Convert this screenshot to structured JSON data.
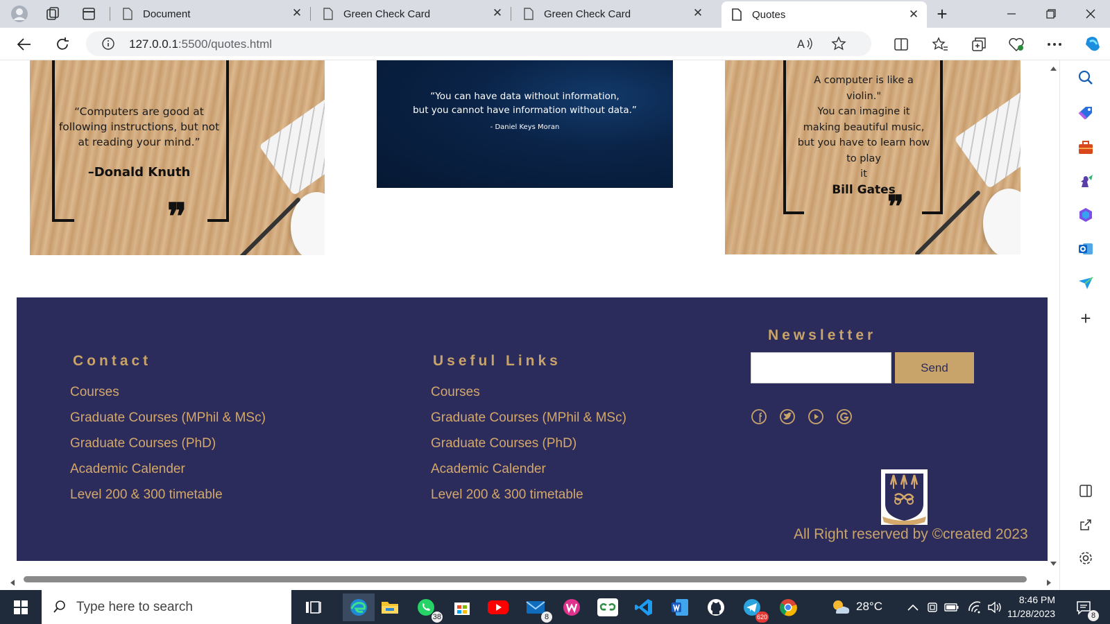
{
  "browser": {
    "tabs": [
      {
        "title": "Document",
        "active": false
      },
      {
        "title": "Green Check Card",
        "active": false
      },
      {
        "title": "Green Check Card",
        "active": false
      },
      {
        "title": "Quotes",
        "active": true
      }
    ],
    "url_host": "127.0.0.1",
    "url_rest": ":5500/quotes.html"
  },
  "quotes": [
    {
      "text_lines": [
        "“Computers are good at",
        "following instructions, but not",
        "at reading your mind.”"
      ],
      "author": "–Donald Knuth"
    },
    {
      "text_lines": [
        "“You can have data without information,",
        "but you cannot have information without data.”"
      ],
      "author": "- Daniel Keys Moran"
    },
    {
      "text_lines": [
        "A computer is like a",
        "violin.\"",
        "You can imagine it",
        "making beautiful music,",
        "but you have to learn how",
        "to play",
        "it"
      ],
      "author": "Bill Gates"
    }
  ],
  "footer": {
    "contact_title": "Contact",
    "contact_links": [
      "Courses",
      "Graduate Courses (MPhil & MSc)",
      "Graduate Courses (PhD)",
      "Academic Calender",
      "Level 200 & 300 timetable"
    ],
    "useful_title": "Useful Links",
    "useful_links": [
      "Courses",
      "Graduate Courses (MPhil & MSc)",
      "Graduate Courses (PhD)",
      "Academic Calender",
      "Level 200 & 300 timetable"
    ],
    "newsletter_title": "Newsletter",
    "newsletter_value": "",
    "send_label": "Send",
    "social_icons": [
      "facebook-icon",
      "twitter-icon",
      "youtube-icon",
      "google-icon"
    ],
    "copyright": "All Right reserved by ©created 2023"
  },
  "taskbar": {
    "search_placeholder": "Type here to search",
    "whatsapp_badge": "38",
    "mail_badge": "8",
    "telegram_badge": "620",
    "notification_badge": "8",
    "temperature": "28°C",
    "time": "8:46 PM",
    "date": "11/28/2023"
  },
  "colors": {
    "footer_bg": "#2b2b5c",
    "accent_gold": "#c9a46a"
  }
}
